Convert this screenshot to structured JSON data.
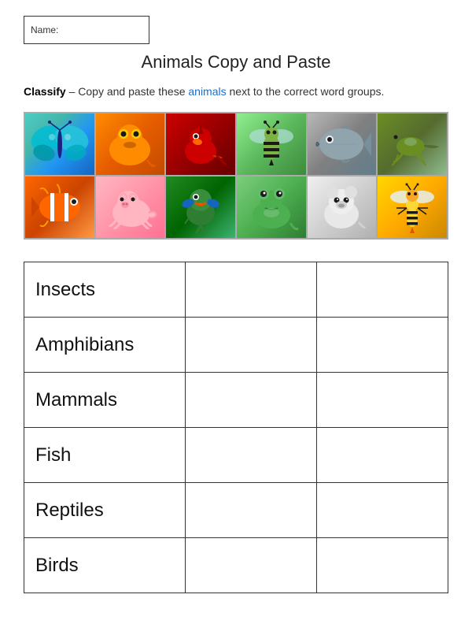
{
  "name_label": "Name:",
  "title": "Animals Copy and Paste",
  "instructions": {
    "prefix": "Classify",
    "middle": " – Copy and paste these ",
    "animals_word": "animals",
    "suffix": " next to the correct word groups."
  },
  "animals": [
    {
      "name": "butterfly",
      "row": 1,
      "col": 1,
      "css_class": "butterfly",
      "emoji": "🦋"
    },
    {
      "name": "orange-frog",
      "row": 1,
      "col": 2,
      "css_class": "frog-orange",
      "emoji": "🐸"
    },
    {
      "name": "cardinal-bird",
      "row": 1,
      "col": 3,
      "css_class": "cardinal",
      "emoji": "🐦"
    },
    {
      "name": "bee",
      "row": 1,
      "col": 4,
      "css_class": "bee",
      "emoji": "🐝"
    },
    {
      "name": "fish-mouth",
      "row": 1,
      "col": 5,
      "css_class": "fish-mouth",
      "emoji": "🐟"
    },
    {
      "name": "lizard",
      "row": 1,
      "col": 6,
      "css_class": "lizard",
      "emoji": "🦎"
    },
    {
      "name": "clownfish",
      "row": 2,
      "col": 1,
      "css_class": "clownfish",
      "emoji": "🐠"
    },
    {
      "name": "pig",
      "row": 2,
      "col": 2,
      "css_class": "pig",
      "emoji": "🐷"
    },
    {
      "name": "parrot",
      "row": 2,
      "col": 3,
      "css_class": "parrot",
      "emoji": "🦜"
    },
    {
      "name": "green-frog",
      "row": 2,
      "col": 4,
      "css_class": "frog-green",
      "emoji": "🐸"
    },
    {
      "name": "polar-bear",
      "row": 2,
      "col": 5,
      "css_class": "polar-bear",
      "emoji": "🐻‍❄️"
    },
    {
      "name": "wasp",
      "row": 2,
      "col": 6,
      "css_class": "wasp",
      "emoji": "🐝"
    }
  ],
  "categories": [
    {
      "label": "Insects"
    },
    {
      "label": "Amphibians"
    },
    {
      "label": "Mammals"
    },
    {
      "label": "Fish"
    },
    {
      "label": "Reptiles"
    },
    {
      "label": "Birds"
    }
  ]
}
